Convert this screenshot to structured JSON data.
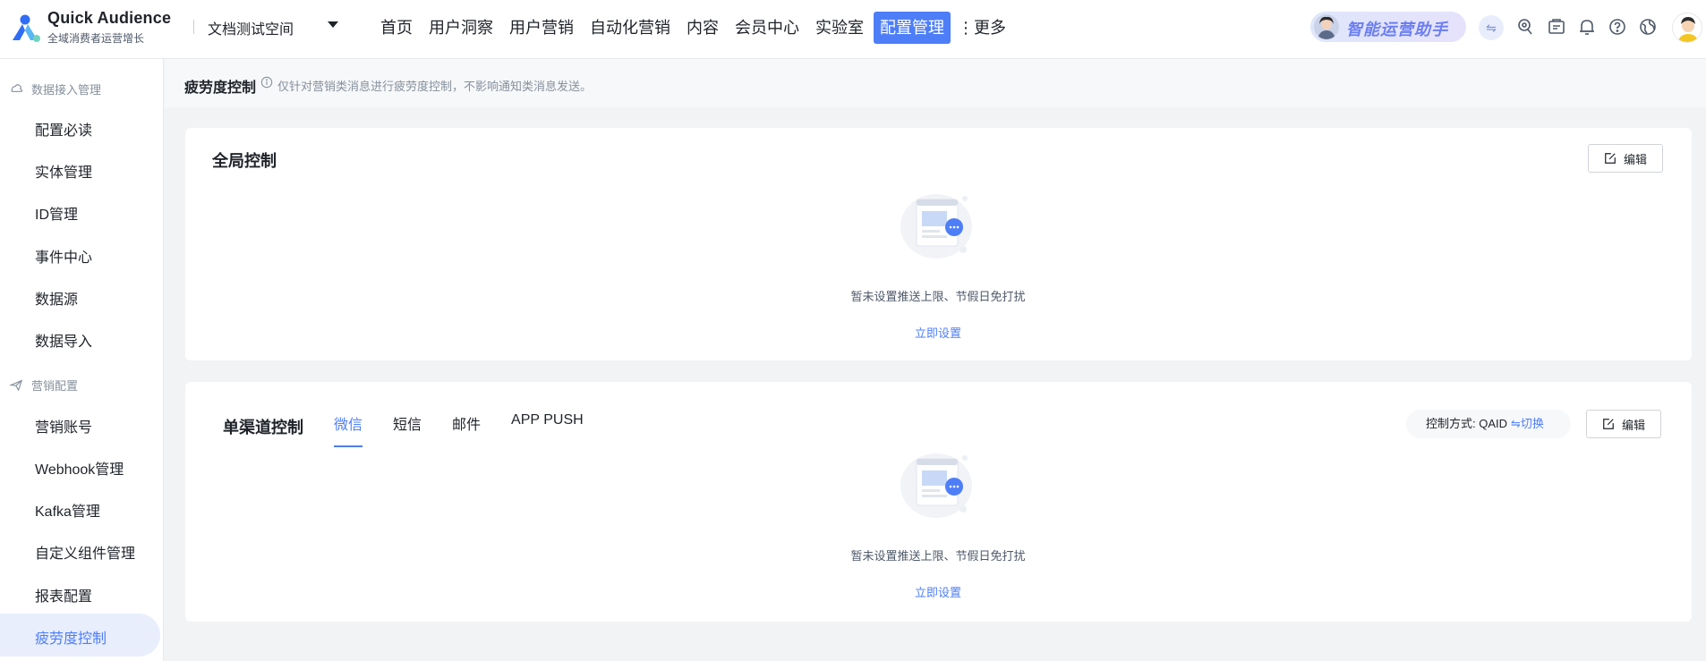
{
  "header": {
    "brand_title": "Quick Audience",
    "brand_subtitle": "全域消费者运营增长",
    "workspace": "文档测试空间",
    "nav": [
      "首页",
      "用户洞察",
      "用户营销",
      "自动化营销",
      "内容",
      "会员中心",
      "实验室",
      "配置管理"
    ],
    "nav_active_index": 7,
    "more_label": "⋮更多",
    "assistant_label": "智能运营助手",
    "icons": [
      "switch-icon",
      "map-pin-icon",
      "message-box-icon",
      "bell-icon",
      "help-icon",
      "globe-icon"
    ]
  },
  "sidebar": {
    "group1": "数据接入管理",
    "group1_items": [
      "配置必读",
      "实体管理",
      "ID管理",
      "事件中心",
      "数据源",
      "数据导入"
    ],
    "group2": "营销配置",
    "group2_items": [
      "营销账号",
      "Webhook管理",
      "Kafka管理",
      "自定义组件管理",
      "报表配置",
      "疲劳度控制"
    ],
    "active_item": "疲劳度控制"
  },
  "page": {
    "title": "疲劳度控制",
    "tip": "仅针对营销类消息进行疲劳度控制，不影响通知类消息发送。"
  },
  "global_card": {
    "title": "全局控制",
    "edit_label": "编辑",
    "empty_text": "暂未设置推送上限、节假日免打扰",
    "empty_link": "立即设置"
  },
  "channel_card": {
    "title": "单渠道控制",
    "tabs": [
      "微信",
      "短信",
      "邮件",
      "APP PUSH"
    ],
    "active_tab": "微信",
    "control_mode_label": "控制方式: QAID",
    "switch_label": "⇋切换",
    "edit_label": "编辑",
    "empty_text": "暂未设置推送上限、节假日免打扰",
    "empty_link": "立即设置"
  },
  "colors": {
    "primary": "#4e7ef7",
    "sidebar_active_bg": "#e8eefc",
    "page_bg": "#f2f3f5"
  }
}
